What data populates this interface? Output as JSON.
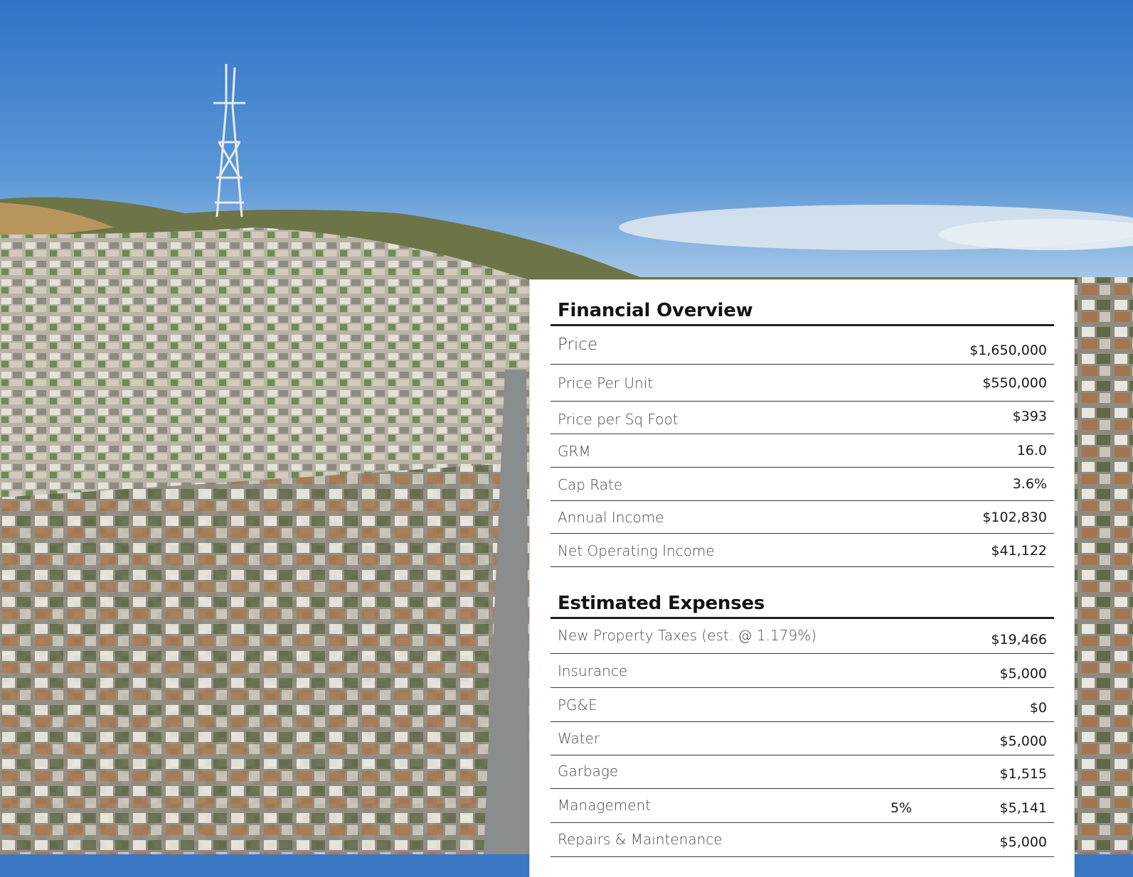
{
  "financial_overview": {
    "title": "Financial Overview",
    "rows": [
      {
        "label": "Price",
        "value": "$1,650,000"
      },
      {
        "label": "Price Per Unit",
        "value": "$550,000"
      },
      {
        "label": "Price per Sq Foot",
        "value": "$393"
      },
      {
        "label": "GRM",
        "value": "16.0"
      },
      {
        "label": "Cap Rate",
        "value": "3.6%"
      },
      {
        "label": "Annual Income",
        "value": "$102,830"
      },
      {
        "label": "Net Operating Income",
        "value": "$41,122"
      }
    ]
  },
  "estimated_expenses": {
    "title": "Estimated Expenses",
    "rows": [
      {
        "label": "New Property Taxes (est. @ 1.179%)",
        "value": "$19,466"
      },
      {
        "label": "Insurance",
        "value": "$5,000"
      },
      {
        "label": "PG&E",
        "value": "$0"
      },
      {
        "label": "Water",
        "value": "$5,000"
      },
      {
        "label": "Garbage",
        "value": "$1,515"
      },
      {
        "label": "Management",
        "percent": "5%",
        "value": "$5,141"
      },
      {
        "label": "Repairs & Maintenance",
        "value": "$5,000"
      }
    ]
  },
  "colors": {
    "sky_top": "#2f74c8",
    "sky_bottom": "#a9c9e8",
    "hill": "#6f7d4a",
    "card_bg": "#ffffff",
    "rule": "#1e1e1e"
  }
}
